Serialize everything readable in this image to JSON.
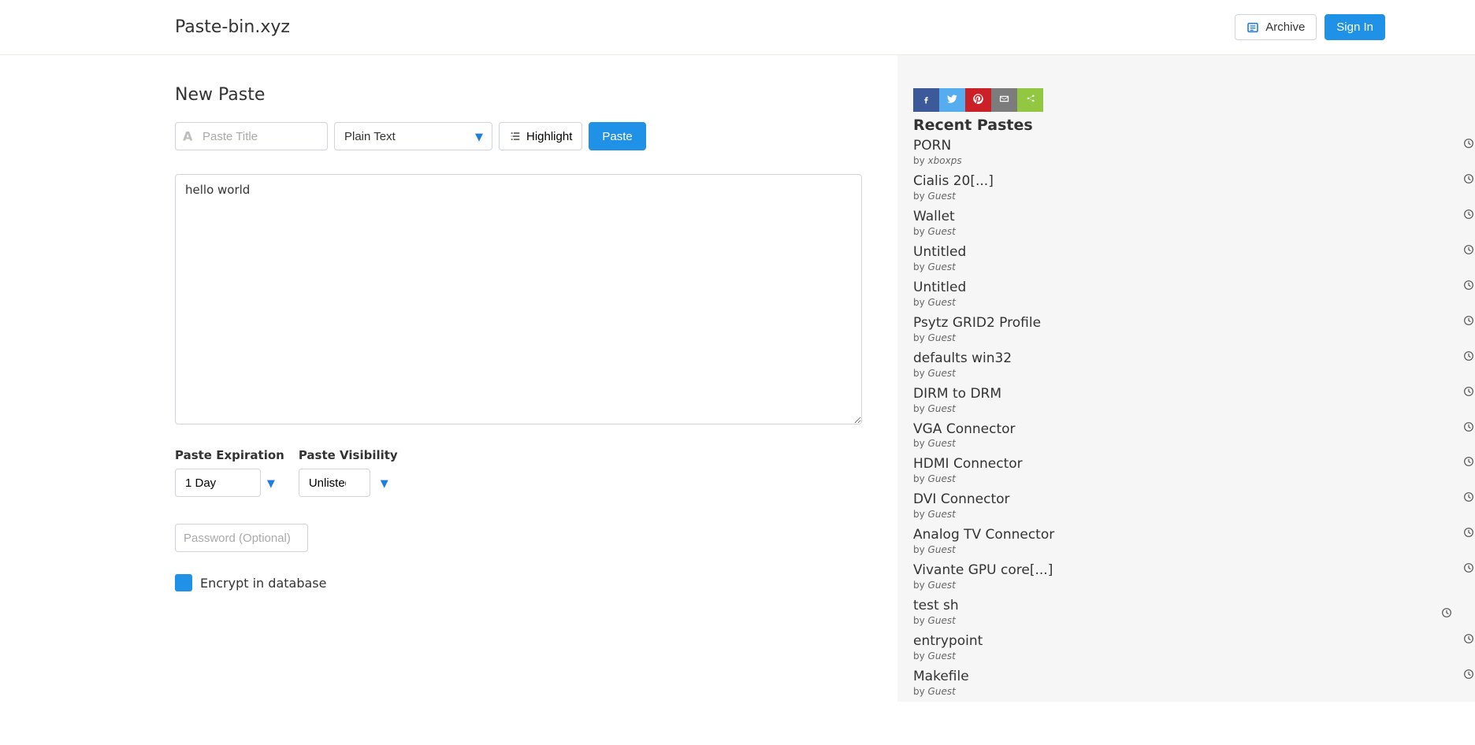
{
  "header": {
    "brand": "Paste-bin.xyz",
    "archive": "Archive",
    "signin": "Sign In"
  },
  "main": {
    "heading": "New Paste",
    "title_placeholder": "Paste Title",
    "lang": "Plain Text",
    "highlight": "Highlight",
    "paste": "Paste",
    "textarea_value": "hello world",
    "expiration_label": "Paste Expiration",
    "visibility_label": "Paste Visibility",
    "expiration_value": "1 Day",
    "visibility_value": "Unlisted",
    "password_placeholder": "Password (Optional)",
    "encrypt_label": "Encrypt in database"
  },
  "sidebar": {
    "title": "Recent Pastes",
    "by": "by",
    "items": [
      {
        "title": "PORN",
        "author": "xboxps"
      },
      {
        "title": "Cialis 20[...]",
        "author": "Guest"
      },
      {
        "title": "Wallet",
        "author": "Guest"
      },
      {
        "title": "Untitled",
        "author": "Guest"
      },
      {
        "title": "Untitled",
        "author": "Guest"
      },
      {
        "title": "Psytz GRID2 Profile",
        "author": "Guest"
      },
      {
        "title": "defaults win32",
        "author": "Guest"
      },
      {
        "title": "DIRM to DRM",
        "author": "Guest"
      },
      {
        "title": "VGA Connector",
        "author": "Guest"
      },
      {
        "title": "HDMI Connector",
        "author": "Guest"
      },
      {
        "title": "DVI Connector",
        "author": "Guest"
      },
      {
        "title": "Analog TV Connector",
        "author": "Guest"
      },
      {
        "title": "Vivante GPU core[...]",
        "author": "Guest"
      },
      {
        "title": "test sh",
        "author": "Guest"
      },
      {
        "title": "entrypoint",
        "author": "Guest"
      },
      {
        "title": "Makefile",
        "author": "Guest"
      }
    ]
  }
}
